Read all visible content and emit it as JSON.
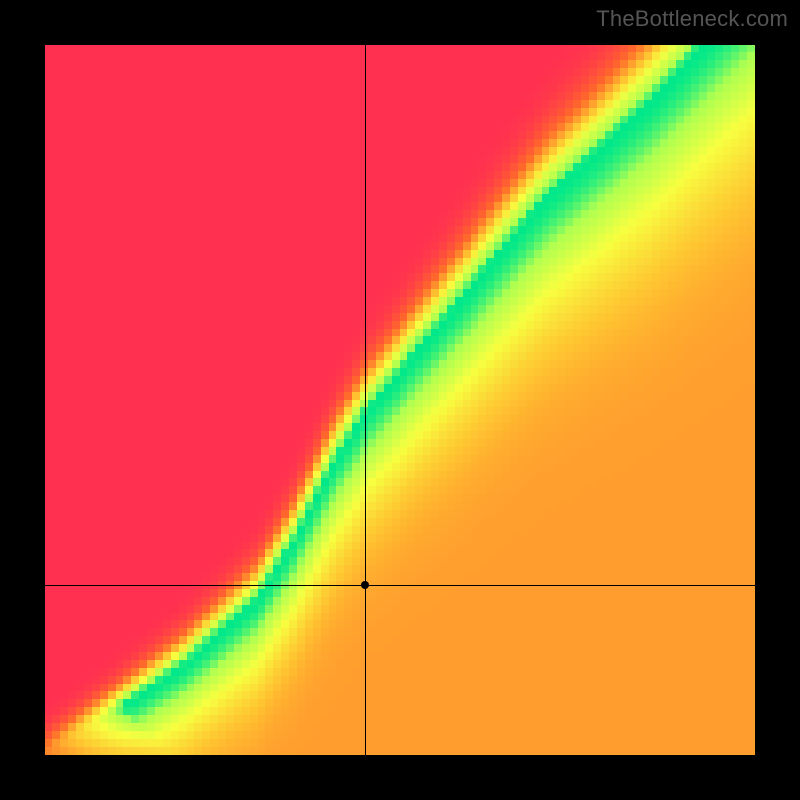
{
  "attribution": "TheBottleneck.com",
  "chart_data": {
    "type": "heatmap",
    "title": "",
    "xlabel": "",
    "ylabel": "",
    "xlim": [
      0,
      100
    ],
    "ylim": [
      0,
      100
    ],
    "grid": false,
    "legend": false,
    "crosshair": {
      "x": 45,
      "y": 24
    },
    "optimal_curve": {
      "description": "Ideal-value ridge approximated as a piecewise curve in normalized [0,100] axes; green where near ridge, red far left/below, yellow-orange far right/above.",
      "points": [
        {
          "x": 0,
          "y": 0
        },
        {
          "x": 10,
          "y": 6
        },
        {
          "x": 20,
          "y": 13
        },
        {
          "x": 30,
          "y": 22
        },
        {
          "x": 35,
          "y": 30
        },
        {
          "x": 40,
          "y": 40
        },
        {
          "x": 45,
          "y": 48
        },
        {
          "x": 55,
          "y": 60
        },
        {
          "x": 70,
          "y": 78
        },
        {
          "x": 85,
          "y": 92
        },
        {
          "x": 100,
          "y": 108
        }
      ]
    },
    "colorscale": [
      {
        "t": 0.0,
        "color": "#ff3050"
      },
      {
        "t": 0.35,
        "color": "#ff6a2a"
      },
      {
        "t": 0.6,
        "color": "#ffc030"
      },
      {
        "t": 0.8,
        "color": "#f7ff40"
      },
      {
        "t": 0.93,
        "color": "#b0ff50"
      },
      {
        "t": 1.0,
        "color": "#00e88a"
      }
    ],
    "resolution": 90
  }
}
